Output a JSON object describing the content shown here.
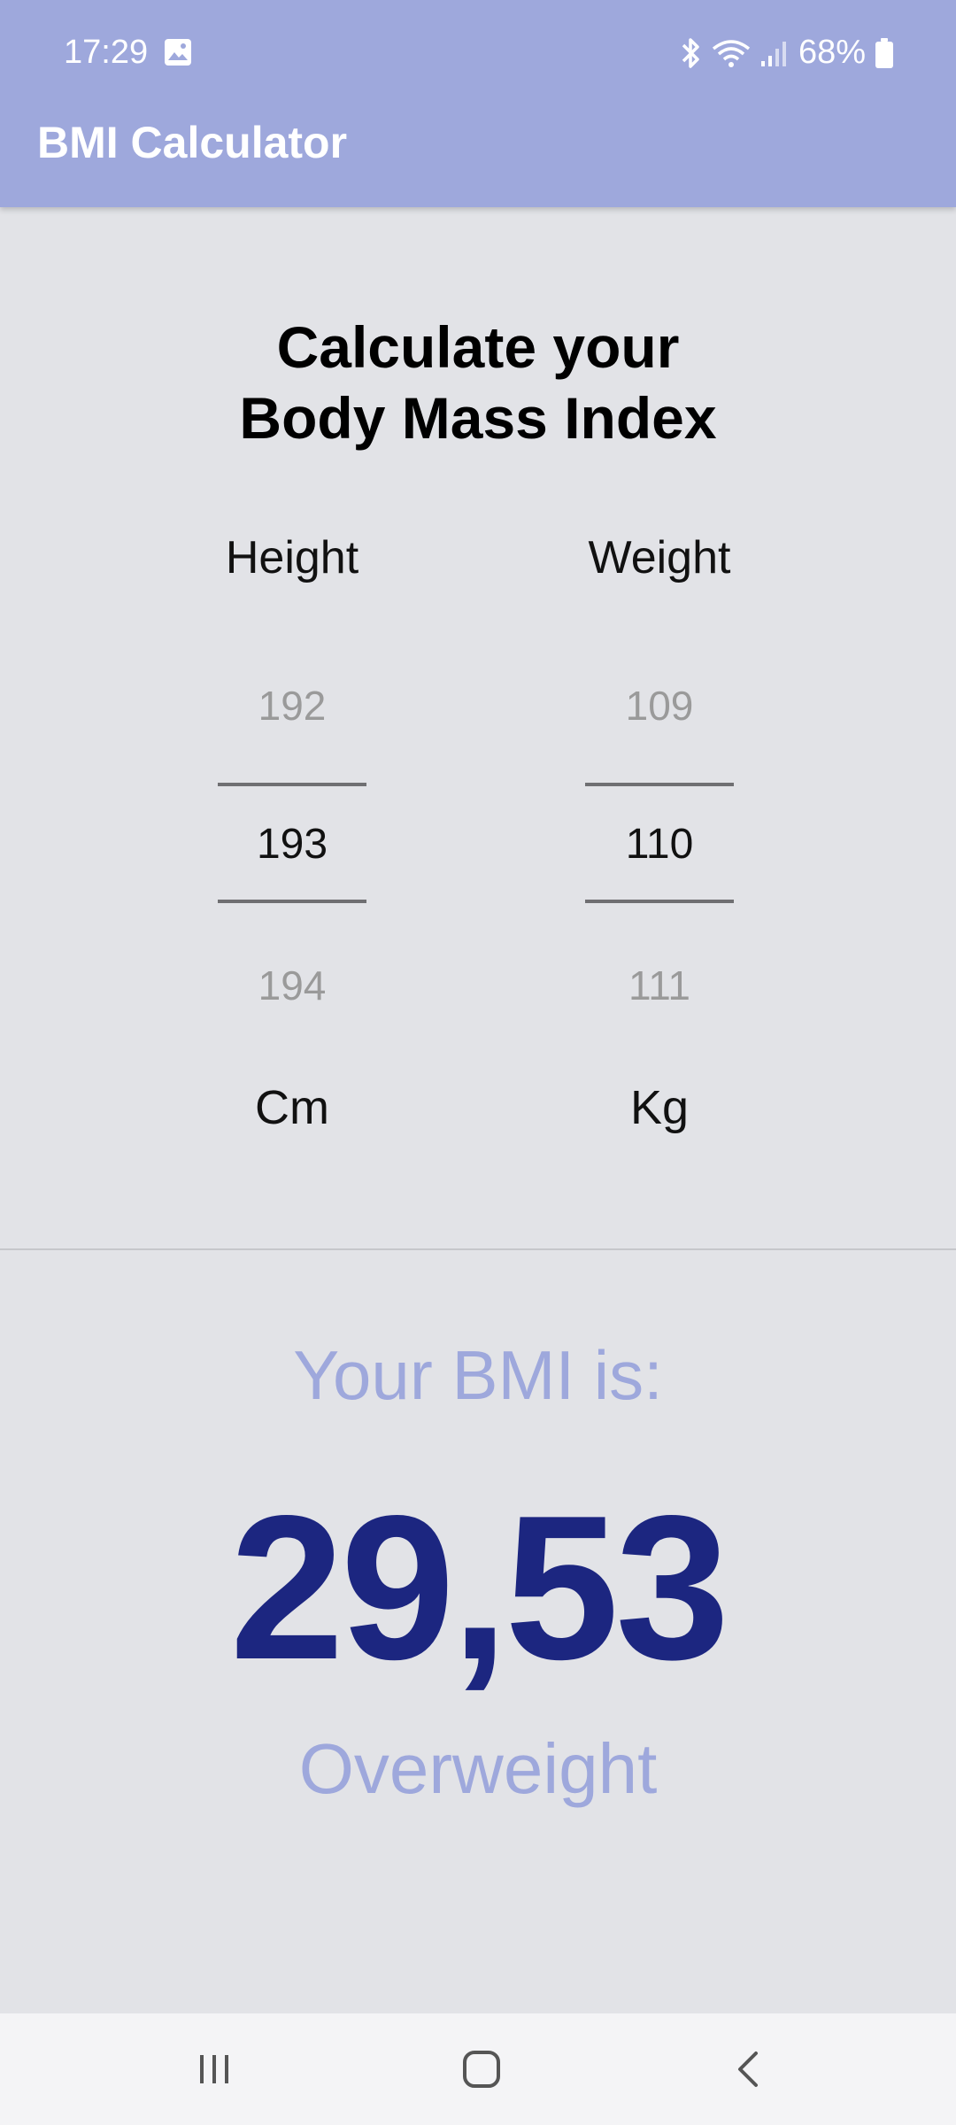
{
  "status_bar": {
    "time": "17:29",
    "battery": "68%",
    "icons": [
      "gallery-icon",
      "bluetooth-icon",
      "wifi-icon",
      "signal-icon",
      "battery-icon"
    ]
  },
  "app_bar": {
    "title": "BMI Calculator",
    "color": "#9ea8dc"
  },
  "main": {
    "title_line1": "Calculate your",
    "title_line2": "Body Mass Index"
  },
  "height_picker": {
    "label": "Height",
    "prev_value": "192",
    "selected_value": "193",
    "next_value": "194",
    "unit": "Cm"
  },
  "weight_picker": {
    "label": "Weight",
    "prev_value": "109",
    "selected_value": "110",
    "next_value": "111",
    "unit": "Kg"
  },
  "result": {
    "label": "Your BMI is:",
    "value": "29,53",
    "category": "Overweight",
    "value_color": "#1c2680",
    "accent_color": "#9ea8dc"
  },
  "nav_bar": {
    "icons": [
      "recents-icon",
      "home-icon",
      "back-icon"
    ]
  }
}
